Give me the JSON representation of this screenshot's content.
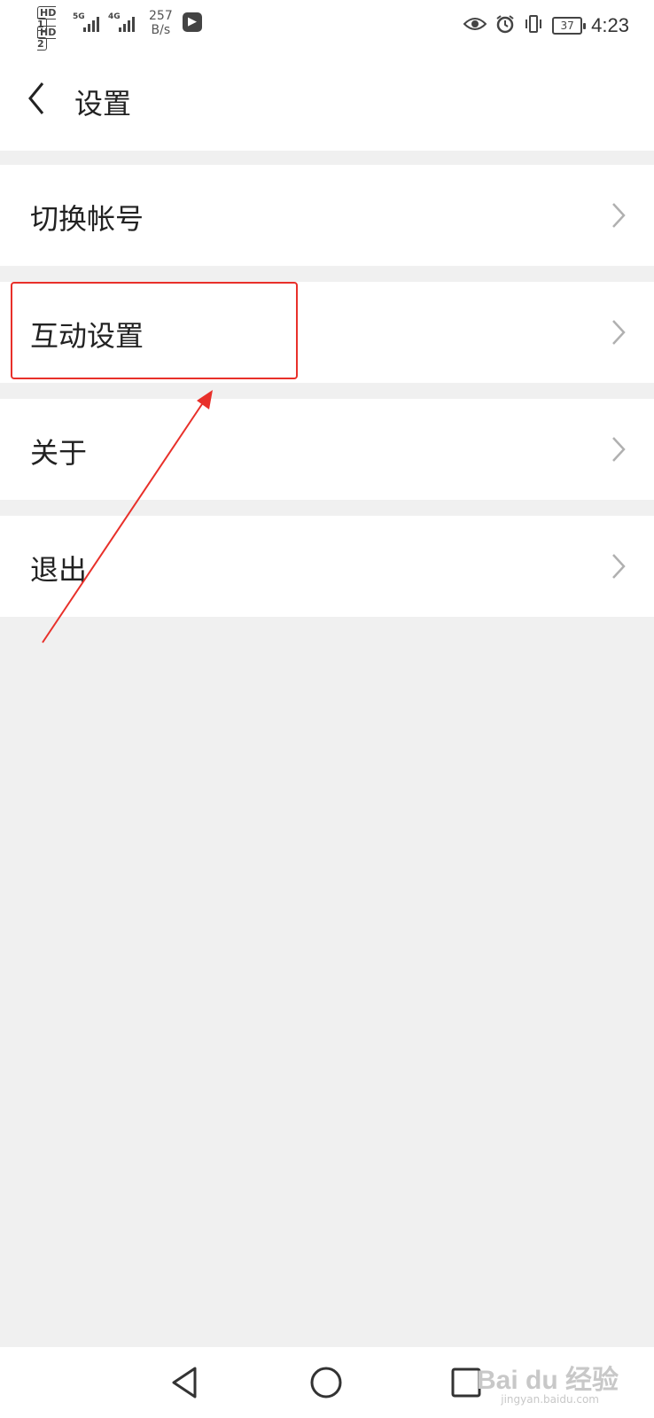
{
  "status_bar": {
    "sim1": "HD 1",
    "sim2": "HD 2",
    "network1": "5G",
    "network2": "4G",
    "speed_value": "257",
    "speed_unit": "B/s",
    "battery": "37",
    "time": "4:23",
    "icons": [
      "eye-icon",
      "alarm-icon",
      "vibrate-icon",
      "battery-icon"
    ]
  },
  "header": {
    "title": "设置",
    "back_icon": "chevron-left-icon"
  },
  "menu_items": [
    {
      "label": "切换帐号"
    },
    {
      "label": "互动设置"
    },
    {
      "label": "关于"
    },
    {
      "label": "退出"
    }
  ],
  "annotation": {
    "highlight_color": "#e8302a"
  },
  "nav_bar": {
    "icons": [
      "back-triangle-icon",
      "home-circle-icon",
      "recents-square-icon"
    ]
  },
  "watermark": {
    "text": "Bai du 经验",
    "sub": "jingyan.baidu.com"
  }
}
